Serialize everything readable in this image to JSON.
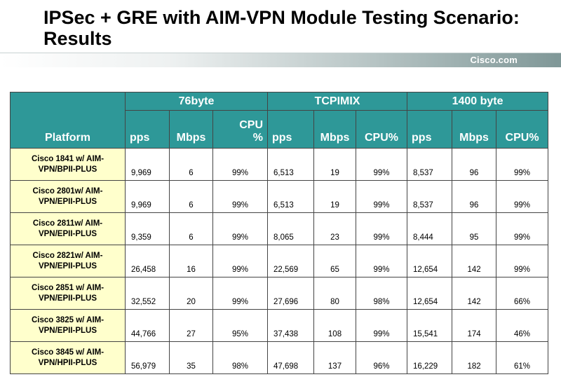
{
  "title": "IPSec + GRE  with AIM-VPN Module Testing Scenario:\nResults",
  "brand": "Cisco.com",
  "table": {
    "platform_header": "Platform",
    "groups": [
      "76byte",
      "TCPIMIX",
      "1400 byte"
    ],
    "subheaders": [
      "pps",
      "Mbps",
      "CPU\n%",
      "pps",
      "Mbps",
      "CPU%",
      "pps",
      "Mbps",
      "CPU%"
    ],
    "rows": [
      {
        "platform": "Cisco 1841 w/ AIM-\nVPN/BPII-PLUS",
        "values": [
          "9,969",
          "6",
          "99%",
          "6,513",
          "19",
          "99%",
          "8,537",
          "96",
          "99%"
        ]
      },
      {
        "platform": "Cisco 2801w/ AIM-\nVPN/EPII-PLUS",
        "values": [
          "9,969",
          "6",
          "99%",
          "6,513",
          "19",
          "99%",
          "8,537",
          "96",
          "99%"
        ]
      },
      {
        "platform": "Cisco 2811w/ AIM-\nVPN/EPII-PLUS",
        "values": [
          "9,359",
          "6",
          "99%",
          "8,065",
          "23",
          "99%",
          "8,444",
          "95",
          "99%"
        ]
      },
      {
        "platform": "Cisco 2821w/ AIM-\nVPN/EPII-PLUS",
        "values": [
          "26,458",
          "16",
          "99%",
          "22,569",
          "65",
          "99%",
          "12,654",
          "142",
          "99%"
        ]
      },
      {
        "platform": "Cisco 2851 w/ AIM-\nVPN/EPII-PLUS",
        "values": [
          "32,552",
          "20",
          "99%",
          "27,696",
          "80",
          "98%",
          "12,654",
          "142",
          "66%"
        ]
      },
      {
        "platform": "Cisco 3825 w/ AIM-\nVPN/EPII-PLUS",
        "values": [
          "44,766",
          "27",
          "95%",
          "37,438",
          "108",
          "99%",
          "15,541",
          "174",
          "46%"
        ]
      },
      {
        "platform": "Cisco 3845 w/ AIM-\nVPN/HPII-PLUS",
        "values": [
          "56,979",
          "35",
          "98%",
          "47,698",
          "137",
          "96%",
          "16,229",
          "182",
          "61%"
        ]
      }
    ]
  }
}
